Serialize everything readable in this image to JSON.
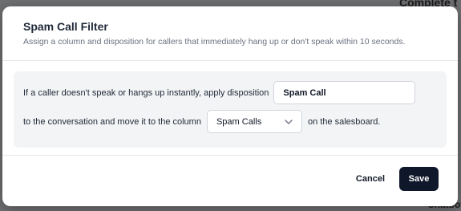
{
  "background": {
    "top_text": "Complete t",
    "bottom_text": "Chatbot"
  },
  "modal": {
    "title": "Spam Call Filter",
    "subtitle": "Assign a column and disposition for callers that immediately hang up or don't speak within 10 seconds.",
    "row1": {
      "text": "If a caller doesn't speak or hangs up instantly, apply disposition",
      "disposition_value": "Spam Call"
    },
    "row2": {
      "text_before": "to the conversation and move it to the column",
      "column_value": "Spam Calls",
      "text_after": "on the salesboard."
    },
    "footer": {
      "cancel_label": "Cancel",
      "save_label": "Save"
    }
  },
  "icons": {
    "select_chevron": "chevron-down-icon"
  },
  "colors": {
    "overlay": "#6f7072",
    "panel": "#f3f4f6",
    "save_button": "#0f172a"
  }
}
